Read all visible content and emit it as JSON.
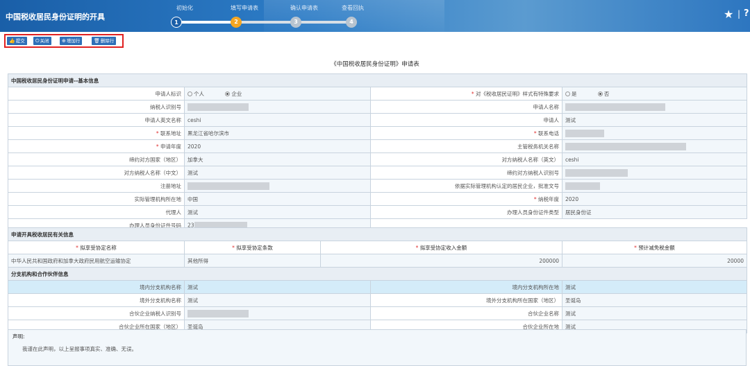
{
  "header": {
    "title": "中国税收居民身份证明的开具",
    "steps": [
      {
        "num": "1",
        "label": "初始化",
        "status": "done"
      },
      {
        "num": "2",
        "label": "填写申请表",
        "status": "current"
      },
      {
        "num": "3",
        "label": "确认申请表",
        "status": "todo"
      },
      {
        "num": "4",
        "label": "查看回执",
        "status": "todo"
      }
    ]
  },
  "colors": {
    "header": "#2d7cc6",
    "step_done": "#1a5fa8",
    "step_current": "#f5a623",
    "step_todo": "#b8c4d0",
    "toolbar_border": "#e02020",
    "button": "#2f6fb8",
    "required": "#e03030"
  },
  "toolbar": {
    "buttons": [
      {
        "label": "提交",
        "icon": "thumbs-up-icon"
      },
      {
        "label": "关闭",
        "icon": "power-icon"
      },
      {
        "label": "增加行",
        "icon": "plus-circle-icon"
      },
      {
        "label": "删除行",
        "icon": "trash-icon"
      }
    ]
  },
  "form": {
    "title": "《中国税收居民身份证明》申请表",
    "basic": {
      "section": "中国税收居民身份证明申请--基本信息",
      "rows": [
        {
          "l1": "申请人标识",
          "l2": "对《税收居民证明》样式有特殊要求",
          "r2": "是",
          "r2b": "否"
        },
        {
          "l1": "纳税人识别号",
          "l2": "申请人名称"
        },
        {
          "l1": "申请人英文名称",
          "v1": "ceshi",
          "l2": "申请人",
          "v2": "测试"
        },
        {
          "l1": "联系地址",
          "v1": "黑龙江省哈尔滨市",
          "l2": "联系电话"
        },
        {
          "l1": "申请年度",
          "v1": "2020",
          "l2": "主管税务机关名称"
        },
        {
          "l1": "缔约对方国家（地区）",
          "v1": "加拿大",
          "l2": "对方纳税人名称（英文）",
          "v2": "ceshi"
        },
        {
          "l1": "对方纳税人名称（中文）",
          "v1": "测试",
          "l2": "缔约对方纳税人识别号"
        },
        {
          "l1": "注册地址",
          "l2": "依据实际管理机构认定的居民企业，批准文号"
        },
        {
          "l1": "实际管理机构所在地",
          "v1": "中国",
          "l2": "纳税年度",
          "v2": "2020"
        },
        {
          "l1": "代理人",
          "v1": "测试",
          "l2": "办理人员身份证件类型",
          "v2": "居民身份证"
        },
        {
          "l1": "办理人员身份证件号码",
          "v1": "23"
        }
      ],
      "applicant_options": [
        "个人",
        "企业"
      ]
    },
    "treaty": {
      "section": "申请开具税收居民有关信息",
      "headers": [
        "拟享受协定名称",
        "拟享受协定条款",
        "拟享受协定收入金额",
        "预计减免税金额"
      ],
      "row": [
        "中华人民共和国政府和加拿大政府民用航空运输协定",
        "其他所得",
        "200000",
        "20000"
      ]
    },
    "branch": {
      "section": "分支机构和合作伙伴信息",
      "rows": [
        {
          "l1": "境内分支机构名称",
          "v1": "测试",
          "l2": "境内分支机构所在地",
          "v2": "测试"
        },
        {
          "l1": "境外分支机构名称",
          "v1": "测试",
          "l2": "境外分支机构所在国家（地区）",
          "v2": "圣诞岛"
        },
        {
          "l1": "合伙企业纳税人识别号",
          "l2": "合伙企业名称",
          "v2": "测试"
        },
        {
          "l1": "合伙企业所在国家（地区）",
          "v1": "圣诞岛",
          "l2": "合伙企业所在地",
          "v2": "测试"
        }
      ]
    },
    "declaration": {
      "title": "声明:",
      "text": "我谨在此声明，以上呈报事项真实、准确、无误。"
    }
  }
}
